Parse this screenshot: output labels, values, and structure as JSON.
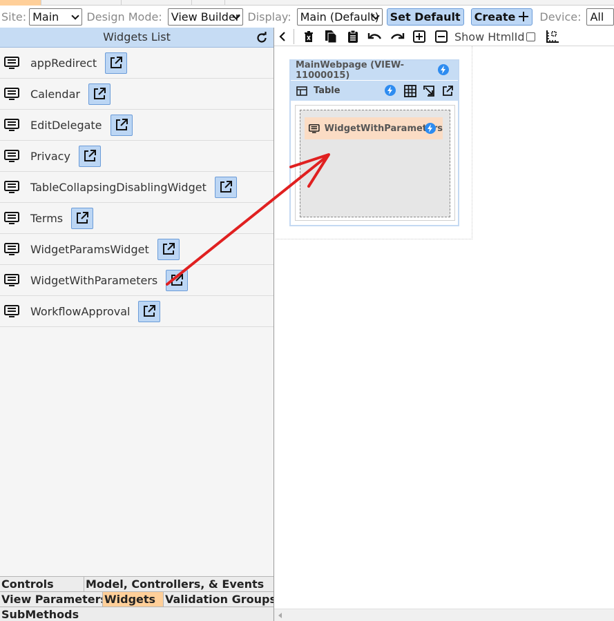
{
  "toolbar": {
    "site_label": "Site:",
    "site_value": "Main",
    "design_mode_label": "Design Mode:",
    "design_mode_value": "View Builder",
    "display_label": "Display:",
    "display_value": "Main (Default)",
    "set_default_label": "Set Default",
    "create_label": "Create",
    "device_label": "Device:",
    "device_value": "All"
  },
  "left_panel": {
    "title": "Widgets List",
    "widgets": [
      {
        "label": "appRedirect"
      },
      {
        "label": "Calendar"
      },
      {
        "label": "EditDelegate"
      },
      {
        "label": "Privacy"
      },
      {
        "label": "TableCollapsingDisablingWidget"
      },
      {
        "label": "Terms"
      },
      {
        "label": "WidgetParamsWidget"
      },
      {
        "label": "WidgetWithParameters"
      },
      {
        "label": "WorkflowApproval"
      }
    ],
    "bottom_tabs": {
      "controls": "Controls",
      "model": "Model, Controllers, & Events",
      "view_parameters": "View Parameters",
      "widgets": "Widgets",
      "validation_groups": "Validation Groups",
      "submethods": "SubMethods"
    }
  },
  "designer": {
    "show_htmlid_label": "Show HtmlId",
    "view_title": "MainWebpage (VIEW-11000015)",
    "table_label": "Table",
    "placed_widget": "WidgetWithParameters"
  },
  "colors": {
    "header_blue": "#c6dcf4",
    "button_blue": "#bcd6f4",
    "active_tab": "#ffcf99",
    "widget_chip": "#fbdcc4",
    "annotation_arrow": "#e02020",
    "bolt_blue": "#2e8cf0"
  }
}
